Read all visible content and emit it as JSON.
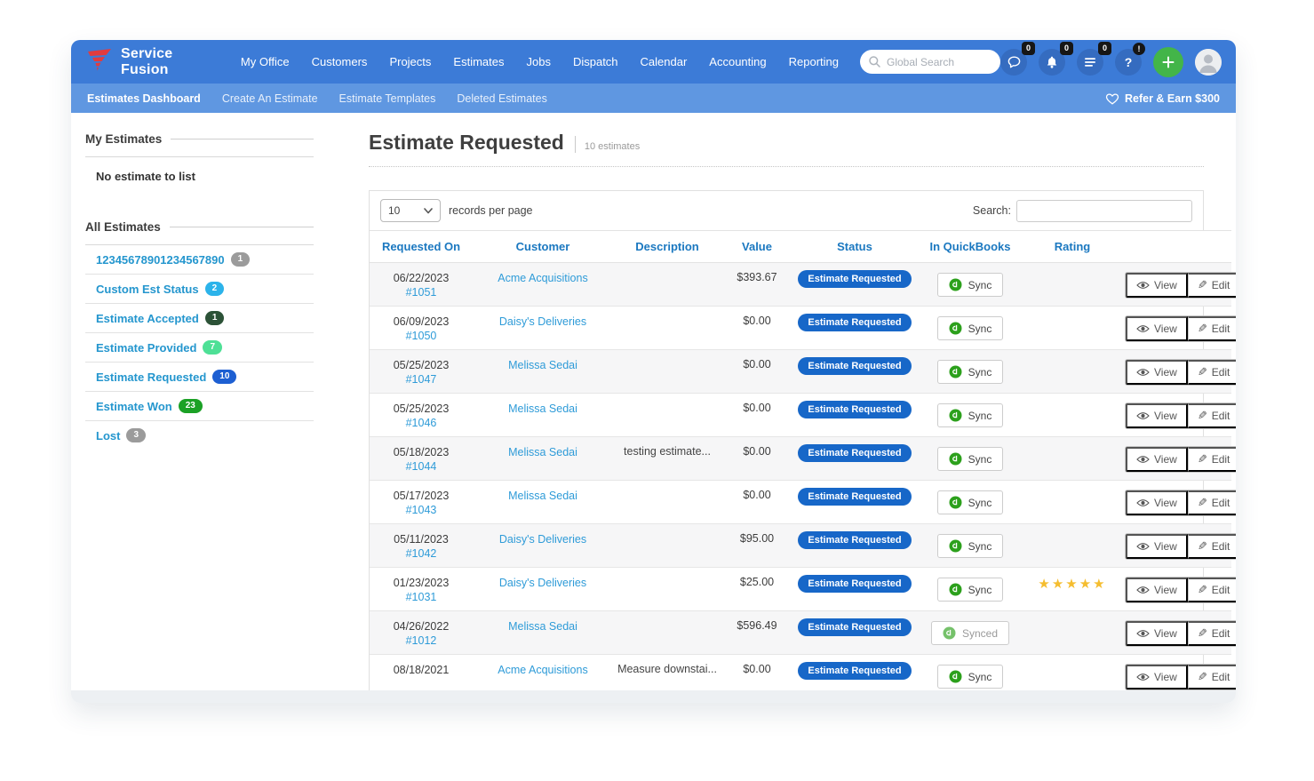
{
  "topnav": {
    "brand": "Service Fusion",
    "items": [
      "My Office",
      "Customers",
      "Projects",
      "Estimates",
      "Jobs",
      "Dispatch",
      "Calendar",
      "Accounting",
      "Reporting"
    ],
    "search_placeholder": "Global Search",
    "chat_badge": "0",
    "notifications_badge": "0",
    "tasks_badge": "0",
    "help_glyph": "?",
    "help_badge": "!"
  },
  "subnav": {
    "items": [
      "Estimates Dashboard",
      "Create An Estimate",
      "Estimate Templates",
      "Deleted Estimates"
    ],
    "refer_label": "Refer & Earn $300"
  },
  "sidebar": {
    "my_estimates_title": "My Estimates",
    "no_estimates_text": "No estimate to list",
    "all_estimates_title": "All Estimates",
    "filters": [
      {
        "label": "12345678901234567890",
        "count": "1",
        "color": "#9b9b9b"
      },
      {
        "label": "Custom Est Status",
        "count": "2",
        "color": "#2cb3ea"
      },
      {
        "label": "Estimate Accepted",
        "count": "1",
        "color": "#2c5237"
      },
      {
        "label": "Estimate Provided",
        "count": "7",
        "color": "#4ee096"
      },
      {
        "label": "Estimate Requested",
        "count": "10",
        "color": "#1d5fd2"
      },
      {
        "label": "Estimate Won",
        "count": "23",
        "color": "#1ba125"
      },
      {
        "label": "Lost",
        "count": "3",
        "color": "#9b9b9b"
      }
    ]
  },
  "main": {
    "title": "Estimate Requested",
    "subtitle": "10 estimates",
    "records_per_page_value": "10",
    "records_per_page_label": "records per page",
    "search_label": "Search:",
    "table": {
      "headers": [
        "Requested On",
        "Customer",
        "Description",
        "Value",
        "Status",
        "In QuickBooks",
        "Rating",
        ""
      ],
      "view_label": "View",
      "edit_label": "Edit",
      "rows": [
        {
          "date": "06/22/2023",
          "number": "#1051",
          "customer": "Acme Acquisitions",
          "description": "",
          "value": "$393.67",
          "status": "Estimate Requested",
          "qb": "Sync",
          "rating": ""
        },
        {
          "date": "06/09/2023",
          "number": "#1050",
          "customer": "Daisy's Deliveries",
          "description": "",
          "value": "$0.00",
          "status": "Estimate Requested",
          "qb": "Sync",
          "rating": ""
        },
        {
          "date": "05/25/2023",
          "number": "#1047",
          "customer": "Melissa Sedai",
          "description": "",
          "value": "$0.00",
          "status": "Estimate Requested",
          "qb": "Sync",
          "rating": ""
        },
        {
          "date": "05/25/2023",
          "number": "#1046",
          "customer": "Melissa Sedai",
          "description": "",
          "value": "$0.00",
          "status": "Estimate Requested",
          "qb": "Sync",
          "rating": ""
        },
        {
          "date": "05/18/2023",
          "number": "#1044",
          "customer": "Melissa Sedai",
          "description": "testing estimate...",
          "value": "$0.00",
          "status": "Estimate Requested",
          "qb": "Sync",
          "rating": ""
        },
        {
          "date": "05/17/2023",
          "number": "#1043",
          "customer": "Melissa Sedai",
          "description": "",
          "value": "$0.00",
          "status": "Estimate Requested",
          "qb": "Sync",
          "rating": ""
        },
        {
          "date": "05/11/2023",
          "number": "#1042",
          "customer": "Daisy's Deliveries",
          "description": "",
          "value": "$95.00",
          "status": "Estimate Requested",
          "qb": "Sync",
          "rating": ""
        },
        {
          "date": "01/23/2023",
          "number": "#1031",
          "customer": "Daisy's Deliveries",
          "description": "",
          "value": "$25.00",
          "status": "Estimate Requested",
          "qb": "Sync",
          "rating": "★★★★★"
        },
        {
          "date": "04/26/2022",
          "number": "#1012",
          "customer": "Melissa Sedai",
          "description": "",
          "value": "$596.49",
          "status": "Estimate Requested",
          "qb": "Synced",
          "rating": ""
        },
        {
          "date": "08/18/2021",
          "number": "",
          "customer": "Acme Acquisitions",
          "description": "Measure downstai...",
          "value": "$0.00",
          "status": "Estimate Requested",
          "qb": "Sync",
          "rating": ""
        }
      ]
    }
  }
}
